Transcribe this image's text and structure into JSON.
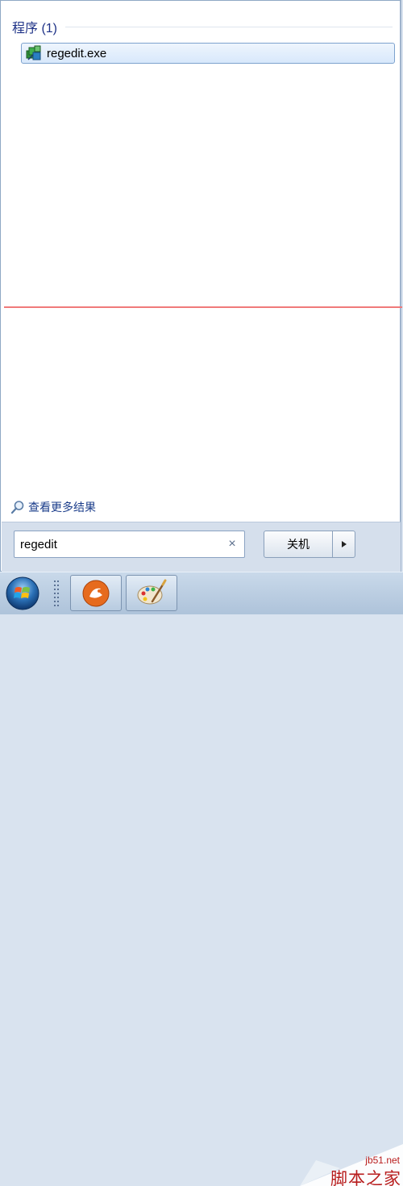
{
  "results": {
    "section_title": "程序 (1)",
    "items": [
      {
        "label": "regedit.exe",
        "icon": "regedit-icon"
      }
    ]
  },
  "more_results": {
    "label": "查看更多结果",
    "icon": "search-icon"
  },
  "search": {
    "value": "regedit",
    "clear_glyph": "×"
  },
  "shutdown": {
    "label": "关机",
    "arrow_icon": "triangle-right-icon"
  },
  "taskbar": {
    "items": [
      {
        "name": "start-orb",
        "icon": "windows-logo-icon"
      },
      {
        "name": "taskbar-app-1",
        "icon": "orange-swirl-app-icon"
      },
      {
        "name": "taskbar-app-2",
        "icon": "paint-palette-icon"
      }
    ]
  },
  "watermark": {
    "url": "jb51.net",
    "name": "脚本之家"
  },
  "colors": {
    "section_title": "#1e3287",
    "highlight_border": "#7da2ce",
    "red_line": "#f07a7a",
    "watermark": "#b81c1c"
  }
}
